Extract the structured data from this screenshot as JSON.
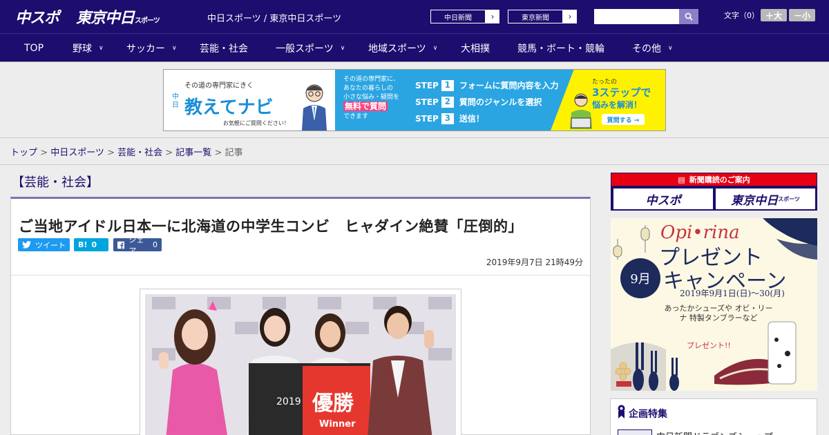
{
  "header": {
    "logo_chuspo": "中スポ",
    "logo_tokyo": "東京中日",
    "logo_tokyo_suffix": "スポーツ",
    "site_names": "中日スポーツ / 東京中日スポーツ",
    "paper_links": [
      {
        "label": "中日新聞"
      },
      {
        "label": "東京新聞"
      }
    ],
    "search": {
      "placeholder": "",
      "icon": "search-icon"
    },
    "font_size": {
      "label": "文字（0）",
      "bigger": "＋大",
      "smaller": "－小"
    }
  },
  "nav": {
    "items": [
      {
        "label": "TOP",
        "dropdown": false
      },
      {
        "label": "野球",
        "dropdown": true
      },
      {
        "label": "サッカー",
        "dropdown": true
      },
      {
        "label": "芸能・社会",
        "dropdown": false
      },
      {
        "label": "一般スポーツ",
        "dropdown": true
      },
      {
        "label": "地域スポーツ",
        "dropdown": true
      },
      {
        "label": "大相撲",
        "dropdown": false
      },
      {
        "label": "競馬・ボート・競輪",
        "dropdown": false
      },
      {
        "label": "その他",
        "dropdown": true
      }
    ]
  },
  "ad_banner": {
    "tagline": "その道の専門家にきく",
    "brand_prefix": "中日",
    "brand": "教えてナビ",
    "note": "お気軽にご質問ください！",
    "intro_lines": [
      "その道の専門家に、",
      "あなたの暮らしの",
      "小さな悩み・疑問を"
    ],
    "highlight": "無料で質問",
    "intro_end": "できます",
    "steps": [
      {
        "label": "STEP",
        "num": "1",
        "text": "フォームに質問内容を入力"
      },
      {
        "label": "STEP",
        "num": "2",
        "text": "質問のジャンルを選択"
      },
      {
        "label": "STEP",
        "num": "3",
        "text": "送信！"
      }
    ],
    "right_small": "たったの",
    "right_big": "3ステップで",
    "right_sub": "悩みを解消！",
    "right_button": "質問する →"
  },
  "breadcrumb": {
    "items": [
      "トップ",
      "中日スポーツ",
      "芸能・社会",
      "記事一覧"
    ],
    "current": "記事"
  },
  "article": {
    "category": "【芸能・社会】",
    "headline": "ご当地アイドル日本一に北海道の中学生コンビ　ヒャダイン絶賛「圧倒的」",
    "share": {
      "tweet": "ツイート",
      "hatena_label": "B!",
      "hatena_count": "0",
      "facebook": "シェア",
      "facebook_count": "0"
    },
    "timestamp": "2019年9月7日 21時49分",
    "photo_sign_year": "2019",
    "photo_sign_main": "優勝",
    "photo_sign_sub": "Winner"
  },
  "sidebar": {
    "subscribe_head": "新聞購読のご案内",
    "subscribe_buttons": [
      {
        "label": "中スポ",
        "suffix": ""
      },
      {
        "label": "東京中日",
        "suffix": "スポーツ"
      }
    ],
    "promo": {
      "brand": "Opi•rina",
      "title1": "プレゼント",
      "title2": "キャンペーン",
      "month": "9月",
      "dates": "2019年9月1日(日)〜30(月)",
      "desc": "あったかシューズや オビ・リーナ 特製タンブラーなど",
      "present": "プレゼント!!"
    },
    "feature_title": "企画特集",
    "feature_item": "中日新聞ドラゴンズショップ"
  },
  "colors": {
    "brand_navy": "#1c0d6e",
    "accent_purple": "#7b72b8",
    "twitter": "#1d9bf0",
    "hatena": "#00a4de",
    "facebook": "#3b5998",
    "subscribe_red": "#e60012"
  }
}
